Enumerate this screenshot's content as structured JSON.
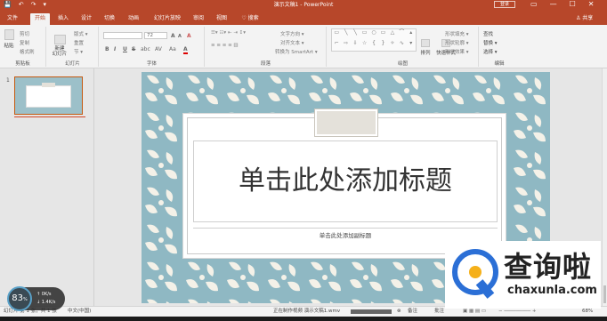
{
  "titlebar": {
    "doc_title": "演示文稿1 - PowerPoint",
    "login": "登录",
    "qa": [
      "💾",
      "↶",
      "↷",
      "▾"
    ],
    "win": [
      "▭",
      "—",
      "☐",
      "✕"
    ]
  },
  "tabs": [
    {
      "label": "文件",
      "active": false
    },
    {
      "label": "开始",
      "active": true
    },
    {
      "label": "插入",
      "active": false
    },
    {
      "label": "设计",
      "active": false
    },
    {
      "label": "切换",
      "active": false
    },
    {
      "label": "动画",
      "active": false
    },
    {
      "label": "幻灯片放映",
      "active": false
    },
    {
      "label": "审阅",
      "active": false
    },
    {
      "label": "视图",
      "active": false
    },
    {
      "label": "♡ 搜索",
      "active": false
    }
  ],
  "share_label": "♙ 共享",
  "ribbon": {
    "clipboard": {
      "paste": "粘贴",
      "cut": "剪切",
      "copy": "复制",
      "format_painter": "格式刷",
      "label": "剪贴板"
    },
    "slides": {
      "new_slide": "新建\n幻灯片",
      "layout": "版式 ▾",
      "reset": "重置",
      "section": "节 ▾",
      "label": "幻灯片"
    },
    "font": {
      "font_name": "",
      "font_size": "72",
      "grow": "A",
      "shrink": "A",
      "clear": "A",
      "bold": "B",
      "italic": "I",
      "underline": "U",
      "strike": "S",
      "shadow": "abc",
      "spacing": "AV",
      "case": "Aa",
      "color": "A",
      "label": "字体"
    },
    "paragraph": {
      "text_direction": "文字方向 ▾",
      "align_text": "对齐文本 ▾",
      "smartart": "转换为 SmartArt ▾",
      "label": "段落"
    },
    "drawing": {
      "arrange": "排列",
      "quick_styles": "快速样式",
      "fill": "形状填充 ▾",
      "outline": "形状轮廓 ▾",
      "effects": "形状效果 ▾",
      "label": "绘图"
    },
    "editing": {
      "find": "查找",
      "replace": "替换 ▾",
      "select": "选择 ▾",
      "label": "编辑"
    }
  },
  "slide_panel": {
    "number": "1"
  },
  "slide": {
    "title_placeholder": "单击此处添加标题",
    "subtitle_placeholder": "单击此处添加副标题"
  },
  "status": {
    "slide_info": "幻灯片 第 1 张，共 1 张",
    "language": "中文(中国)",
    "recording": "正在制作视频 演示文稿1.wmv",
    "notes": "备注",
    "comments": "批注",
    "zoom": "68%"
  },
  "speed": {
    "value": "83",
    "unit": "%",
    "up": "0K/s",
    "down": "1.4K/s"
  },
  "watermark": {
    "brand": "查询啦",
    "url": "chaxunla.com"
  },
  "colors": {
    "accent": "#b7472a",
    "slide_bg": "#8fb8c3",
    "leaf": "#f4f1e8",
    "logo_blue": "#2b6fd6",
    "logo_yellow": "#f5b01a"
  }
}
